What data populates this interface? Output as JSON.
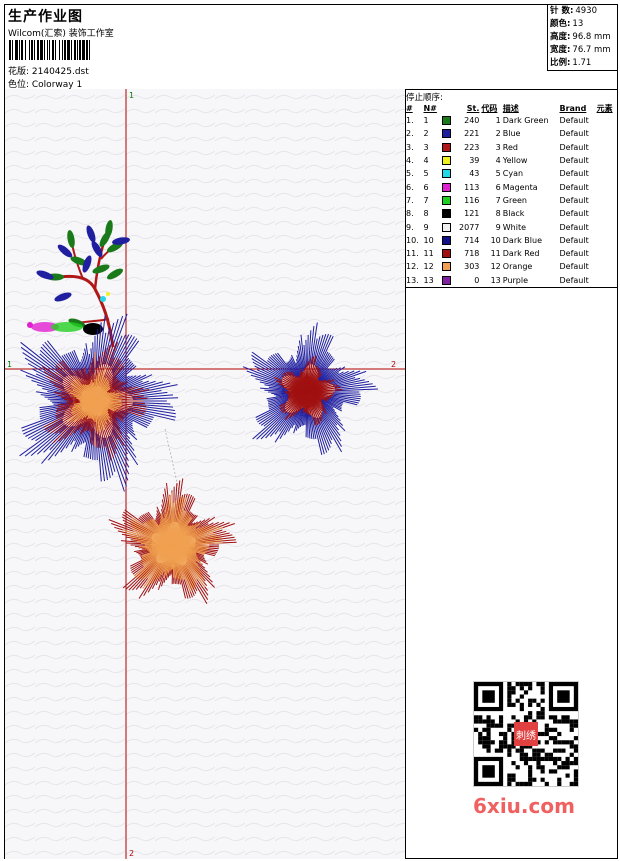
{
  "header": {
    "title": "生产作业图",
    "studio": "Wilcom(汇索) 装饰工作室",
    "design": "花版: 2140425.dst",
    "colorway": "色位: Colorway 1"
  },
  "stats": [
    {
      "label": "针 数:",
      "value": "4930"
    },
    {
      "label": "颜色:",
      "value": "13"
    },
    {
      "label": "高度:",
      "value": "96.8 mm"
    },
    {
      "label": "宽度:",
      "value": "76.7 mm"
    },
    {
      "label": "比例:",
      "value": "1.71"
    }
  ],
  "stop_sequence": {
    "title": "停止顺序:",
    "columns": [
      "#",
      "N#",
      "St.",
      "代码",
      "描述",
      "Brand",
      "元素"
    ],
    "rows": [
      {
        "idx": "1.",
        "n": "1",
        "st": "240",
        "code": "1",
        "desc": "Dark Green",
        "brand": "Default",
        "color": "#1a7a1a"
      },
      {
        "idx": "2.",
        "n": "2",
        "st": "221",
        "code": "2",
        "desc": "Blue",
        "brand": "Default",
        "color": "#1f1fa0"
      },
      {
        "idx": "3.",
        "n": "3",
        "st": "223",
        "code": "3",
        "desc": "Red",
        "brand": "Default",
        "color": "#b01818"
      },
      {
        "idx": "4.",
        "n": "4",
        "st": "39",
        "code": "4",
        "desc": "Yellow",
        "brand": "Default",
        "color": "#f0f020"
      },
      {
        "idx": "5.",
        "n": "5",
        "st": "43",
        "code": "5",
        "desc": "Cyan",
        "brand": "Default",
        "color": "#20d8e8"
      },
      {
        "idx": "6.",
        "n": "6",
        "st": "113",
        "code": "6",
        "desc": "Magenta",
        "brand": "Default",
        "color": "#e020d0"
      },
      {
        "idx": "7.",
        "n": "7",
        "st": "116",
        "code": "7",
        "desc": "Green",
        "brand": "Default",
        "color": "#20d020"
      },
      {
        "idx": "8.",
        "n": "8",
        "st": "121",
        "code": "8",
        "desc": "Black",
        "brand": "Default",
        "color": "#000000"
      },
      {
        "idx": "9.",
        "n": "9",
        "st": "2077",
        "code": "9",
        "desc": "White",
        "brand": "Default",
        "color": "#f0f0f0"
      },
      {
        "idx": "10.",
        "n": "10",
        "st": "714",
        "code": "10",
        "desc": "Dark Blue",
        "brand": "Default",
        "color": "#101088"
      },
      {
        "idx": "11.",
        "n": "11",
        "st": "718",
        "code": "11",
        "desc": "Dark Red",
        "brand": "Default",
        "color": "#a01010"
      },
      {
        "idx": "12.",
        "n": "12",
        "st": "303",
        "code": "12",
        "desc": "Orange",
        "brand": "Default",
        "color": "#f0a050"
      },
      {
        "idx": "13.",
        "n": "13",
        "st": "0",
        "code": "13",
        "desc": "Purple",
        "brand": "Default",
        "color": "#8020a0"
      }
    ]
  },
  "axes": {
    "v_top": "1",
    "v_bottom": "2",
    "h_left": "1",
    "h_right": "2"
  },
  "watermark": "6xiu.com",
  "qr_stamp": "刺绣"
}
